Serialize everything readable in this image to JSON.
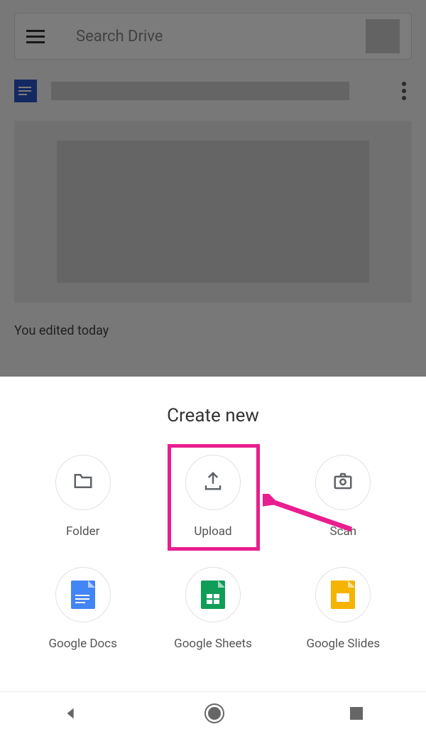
{
  "header": {
    "search_placeholder": "Search Drive"
  },
  "file": {
    "status": "You edited today"
  },
  "sheet": {
    "title": "Create new",
    "items": [
      {
        "label": "Folder",
        "icon": "folder-icon"
      },
      {
        "label": "Upload",
        "icon": "upload-icon"
      },
      {
        "label": "Scan",
        "icon": "camera-icon"
      },
      {
        "label": "Google Docs",
        "icon": "docs-app-icon"
      },
      {
        "label": "Google Sheets",
        "icon": "sheets-app-icon"
      },
      {
        "label": "Google Slides",
        "icon": "slides-app-icon"
      }
    ]
  },
  "annotation": {
    "highlighted_item": "Upload",
    "highlight_color": "#e91e8f"
  }
}
